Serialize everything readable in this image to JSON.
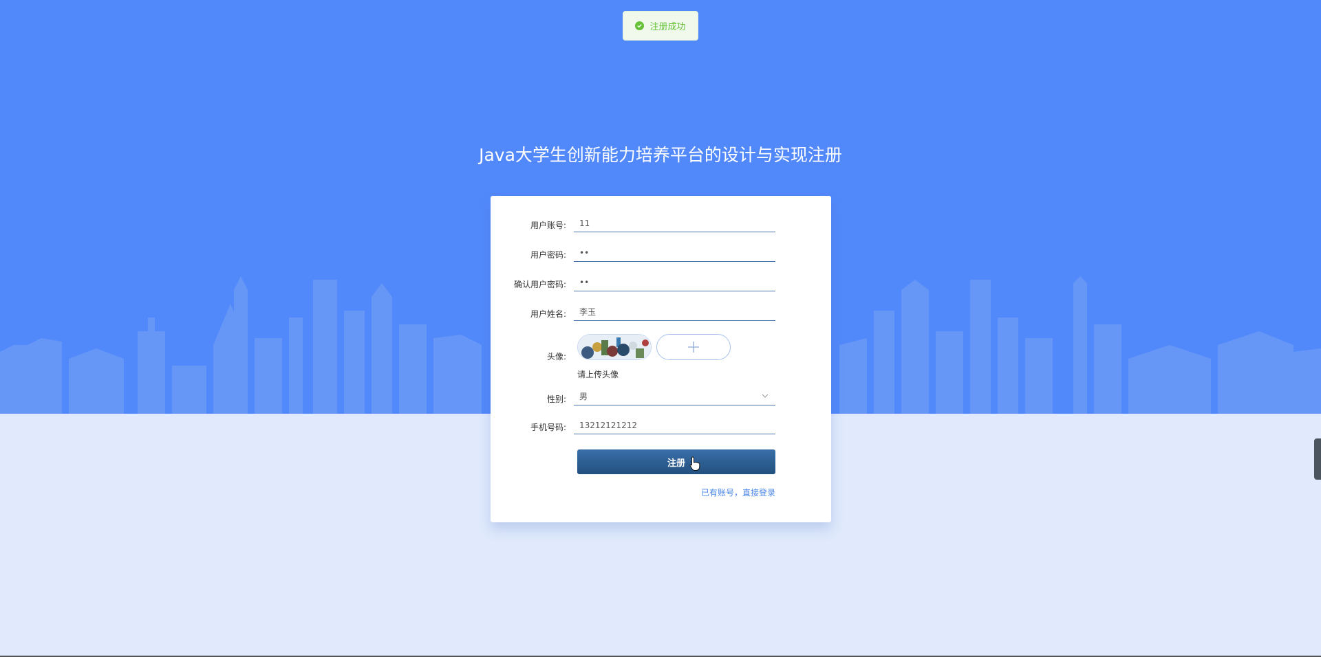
{
  "toast": {
    "icon": "check-circle-icon",
    "text": "注册成功",
    "color": "#67c23a"
  },
  "page": {
    "title": "Java大学生创新能力培养平台的设计与实现注册",
    "bg_color": "#5289fa"
  },
  "form": {
    "account": {
      "label": "用户账号:",
      "value": "11"
    },
    "password": {
      "label": "用户密码:",
      "value": "••"
    },
    "confirm_password": {
      "label": "确认用户密码:",
      "value": "••"
    },
    "name": {
      "label": "用户姓名:",
      "value": "李玉"
    },
    "avatar": {
      "label": "头像:",
      "hint": "请上传头像",
      "add_icon": "plus-icon"
    },
    "gender": {
      "label": "性别:",
      "value": "男",
      "icon": "chevron-down-icon"
    },
    "phone": {
      "label": "手机号码:",
      "value": "13212121212"
    },
    "submit_label": "注册",
    "login_link": "已有账号，直接登录"
  },
  "colors": {
    "button": "#2b5d93",
    "link": "#4a86e8",
    "page_bottom": "#e0eafc"
  }
}
